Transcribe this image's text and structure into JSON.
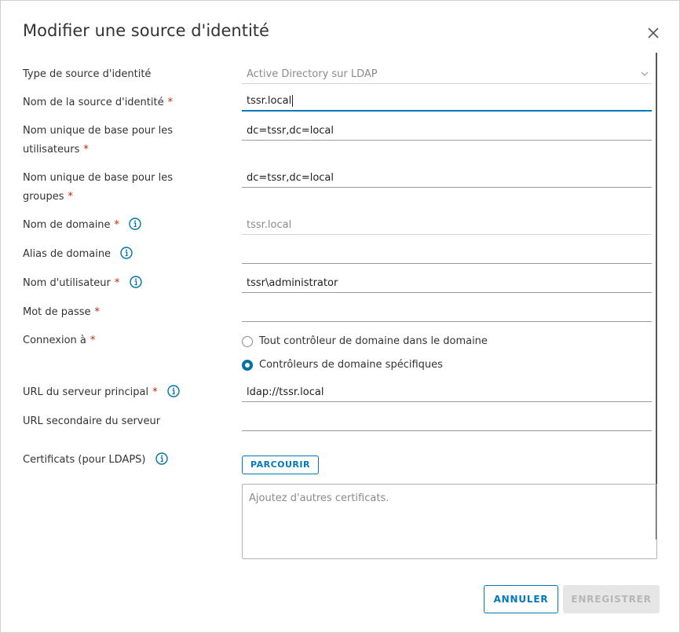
{
  "dialog": {
    "title": "Modifier une source d'identité",
    "close_icon": "close-icon"
  },
  "fields": {
    "source_type": {
      "label": "Type de source d'identité",
      "value": "Active Directory sur LDAP"
    },
    "source_name": {
      "label": "Nom de la source d'identité",
      "value": "tssr.local",
      "required": "*"
    },
    "base_dn_users": {
      "label_line1": "Nom unique de base pour les",
      "label_line2": "utilisateurs",
      "value": "dc=tssr,dc=local",
      "required": "*"
    },
    "base_dn_groups": {
      "label_line1": "Nom unique de base pour les",
      "label_line2": "groupes",
      "value": "dc=tssr,dc=local",
      "required": "*"
    },
    "domain_name": {
      "label": "Nom de domaine",
      "value": "tssr.local",
      "required": "*"
    },
    "domain_alias": {
      "label": "Alias de domaine",
      "value": ""
    },
    "username": {
      "label": "Nom d'utilisateur",
      "value": "tssr\\administrator",
      "required": "*"
    },
    "password": {
      "label": "Mot de passe",
      "value": "",
      "required": "*"
    },
    "connect_to": {
      "label": "Connexion à",
      "required": "*",
      "options": [
        {
          "label": "Tout contrôleur de domaine dans le domaine",
          "checked": false
        },
        {
          "label": "Contrôleurs de domaine spécifiques",
          "checked": true
        }
      ]
    },
    "primary_url": {
      "label": "URL du serveur principal",
      "value": "ldap://tssr.local",
      "required": "*"
    },
    "secondary_url": {
      "label": "URL secondaire du serveur",
      "value": ""
    },
    "certificates": {
      "label": "Certificats (pour LDAPS)",
      "browse_label": "PARCOURIR",
      "placeholder": "Ajoutez d'autres certificats."
    }
  },
  "footer": {
    "cancel_label": "ANNULER",
    "save_label": "ENREGISTRER"
  },
  "colors": {
    "accent": "#0079b8",
    "required": "#c92100",
    "disabled_button_bg": "#e6e6e6"
  }
}
